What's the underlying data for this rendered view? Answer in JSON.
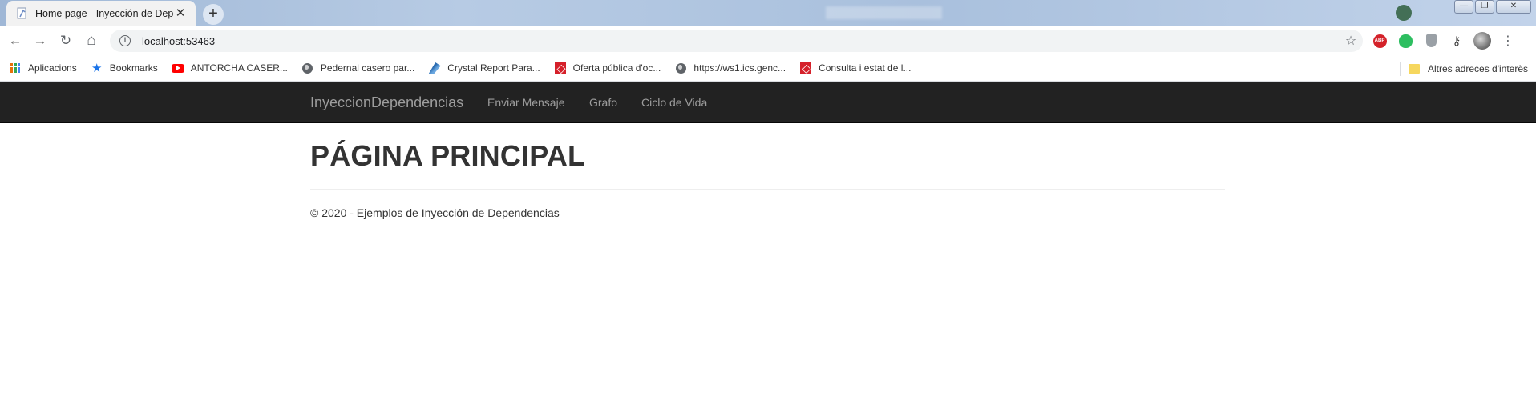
{
  "browser": {
    "tab": {
      "title": "Home page - Inyección de Depe",
      "close_glyph": "✕",
      "new_tab_glyph": "+"
    },
    "window_controls": {
      "minimize": "—",
      "maximize": "❐",
      "close": "✕"
    },
    "toolbar": {
      "back_glyph": "←",
      "forward_glyph": "→",
      "reload_glyph": "↻",
      "home_glyph": "⌂",
      "url": "localhost:53463",
      "info_glyph": "i",
      "star_glyph": "☆",
      "abp_label": "ABP",
      "key_glyph": "⚷",
      "menu_glyph": "⋮"
    },
    "bookmarks": [
      {
        "label": "Aplicacions",
        "icon": "apps-grid-icon"
      },
      {
        "label": "Bookmarks",
        "icon": "star-icon"
      },
      {
        "label": "ANTORCHA CASER...",
        "icon": "youtube-icon"
      },
      {
        "label": "Pedernal casero par...",
        "icon": "globe-icon"
      },
      {
        "label": "Crystal Report Para...",
        "icon": "crystal-reports-icon"
      },
      {
        "label": "Oferta pública d'oc...",
        "icon": "generalitat-icon"
      },
      {
        "label": "https://ws1.ics.genc...",
        "icon": "globe-icon"
      },
      {
        "label": "Consulta i estat de l...",
        "icon": "generalitat-icon"
      }
    ],
    "other_bookmarks": "Altres adreces d'interès"
  },
  "site": {
    "brand": "InyeccionDependencias",
    "nav": [
      "Enviar Mensaje",
      "Grafo",
      "Ciclo de Vida"
    ],
    "heading": "PÁGINA PRINCIPAL",
    "footer": "© 2020 - Ejemplos de Inyección de Dependencias"
  },
  "colors": {
    "navbar_bg": "#222222",
    "navbar_text": "#9d9d9d",
    "heading_text": "#333333"
  }
}
